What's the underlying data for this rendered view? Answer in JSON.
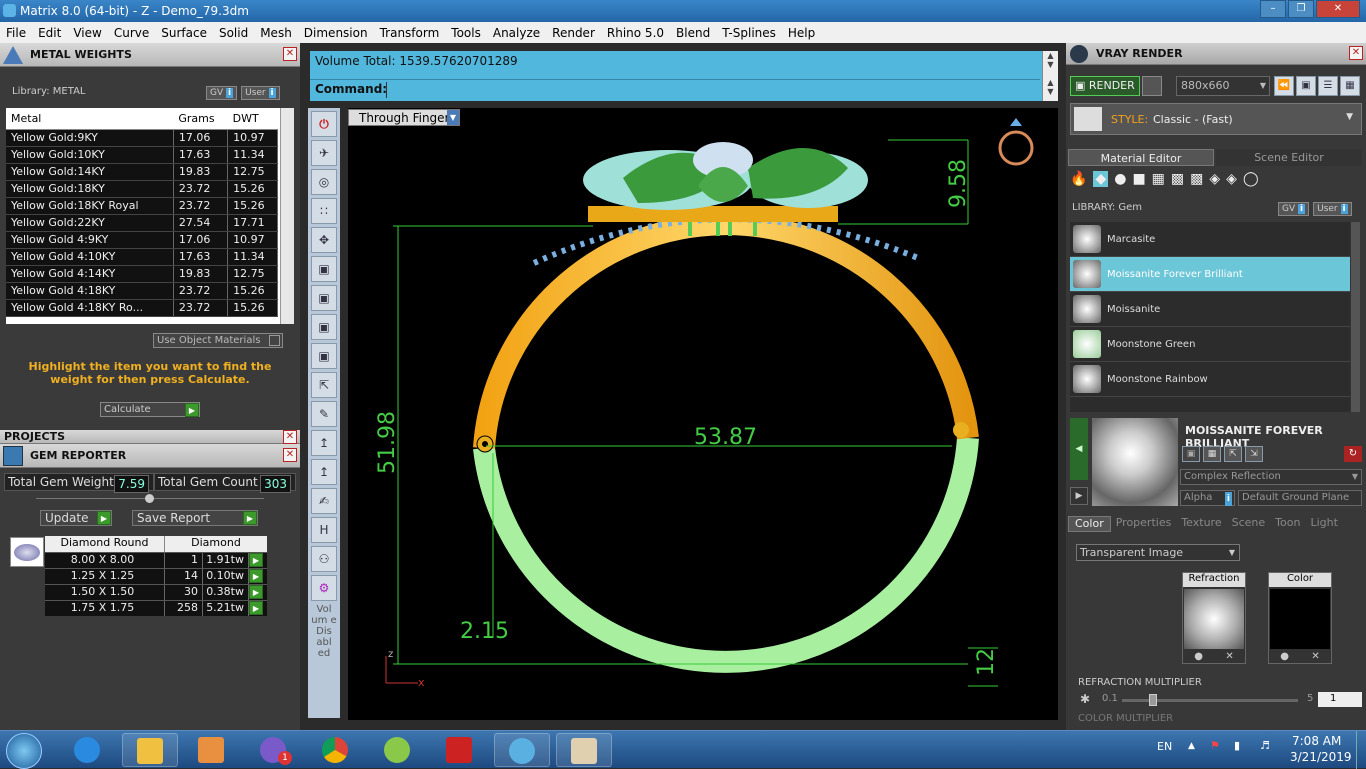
{
  "window": {
    "title": "Matrix 8.0 (64-bit) - Z - Demo_79.3dm"
  },
  "menu": [
    "File",
    "Edit",
    "View",
    "Curve",
    "Surface",
    "Solid",
    "Mesh",
    "Dimension",
    "Transform",
    "Tools",
    "Analyze",
    "Render",
    "Rhino 5.0",
    "Blend",
    "T-Splines",
    "Help"
  ],
  "metal_weights": {
    "title": "METAL WEIGHTS",
    "library_label": "Library: METAL",
    "gv": "GV",
    "user": "User",
    "columns": [
      "Metal",
      "Grams",
      "DWT"
    ],
    "rows": [
      [
        "Yellow Gold:9KY",
        "17.06",
        "10.97"
      ],
      [
        "Yellow Gold:10KY",
        "17.63",
        "11.34"
      ],
      [
        "Yellow Gold:14KY",
        "19.83",
        "12.75"
      ],
      [
        "Yellow Gold:18KY",
        "23.72",
        "15.26"
      ],
      [
        "Yellow Gold:18KY Royal",
        "23.72",
        "15.26"
      ],
      [
        "Yellow Gold:22KY",
        "27.54",
        "17.71"
      ],
      [
        "Yellow Gold 4:9KY",
        "17.06",
        "10.97"
      ],
      [
        "Yellow Gold 4:10KY",
        "17.63",
        "11.34"
      ],
      [
        "Yellow Gold 4:14KY",
        "19.83",
        "12.75"
      ],
      [
        "Yellow Gold 4:18KY",
        "23.72",
        "15.26"
      ],
      [
        "Yellow Gold 4:18KY Ro...",
        "23.72",
        "15.26"
      ]
    ],
    "use_object_materials": "Use Object Materials",
    "hint": "Highlight the item you want to find the weight for then press Calculate.",
    "calculate": "Calculate"
  },
  "projects": {
    "title": "PROJECTS"
  },
  "gem_reporter": {
    "title": "GEM REPORTER",
    "total_weight_label": "Total Gem Weight",
    "total_weight": "7.59",
    "total_count_label": "Total Gem Count",
    "total_count": "303",
    "update": "Update",
    "save_report": "Save Report",
    "header_shape": "Diamond Round",
    "header_type": "Diamond",
    "rows": [
      [
        "8.00 X 8.00",
        "1",
        "1.91tw"
      ],
      [
        "1.25 X 1.25",
        "14",
        "0.10tw"
      ],
      [
        "1.50 X 1.50",
        "30",
        "0.38tw"
      ],
      [
        "1.75 X 1.75",
        "258",
        "5.21tw"
      ]
    ]
  },
  "console": {
    "output": "Volume Total: 1539.57620701289",
    "command_label": "Command:"
  },
  "viewport": {
    "tab": "Through Finger",
    "dim_width": "53.87",
    "dim_height": "51.98",
    "dim_top": "9.58",
    "dim_shank": "2.15",
    "dim_bottom": "12",
    "axis_z": "z",
    "axis_x": "x",
    "volume_disabled": "Vol um e Dis abl ed"
  },
  "vray": {
    "title": "VRAY RENDER",
    "render": "RENDER",
    "resolution": "880x660",
    "style_label": "STYLE:",
    "style_value": "Classic - (Fast)",
    "tabs": [
      "Material Editor",
      "Scene Editor"
    ],
    "library_label": "LIBRARY: Gem",
    "gv": "GV",
    "user": "User",
    "materials": [
      "Marcasite",
      "Moissanite Forever Brilliant",
      "Moissanite",
      "Moonstone Green",
      "Moonstone Rainbow"
    ],
    "selected_title": "MOISSANITE FOREVER BRILLIANT",
    "reflection": "Complex Reflection",
    "alpha": "Alpha",
    "ground": "Default Ground Plane",
    "subtabs": [
      "Color",
      "Properties",
      "Texture",
      "Scene",
      "Toon",
      "Light"
    ],
    "transparent": "Transparent Image",
    "refraction": "Refraction",
    "color": "Color",
    "refraction_multiplier": "REFRACTION MULTIPLIER",
    "rm_min": "0.1",
    "rm_max": "5",
    "rm_value": "1",
    "color_multiplier": "COLOR MULTIPLIER"
  },
  "taskbar": {
    "lang": "EN",
    "time": "7:08 AM",
    "date": "3/21/2019",
    "badge": "1"
  }
}
